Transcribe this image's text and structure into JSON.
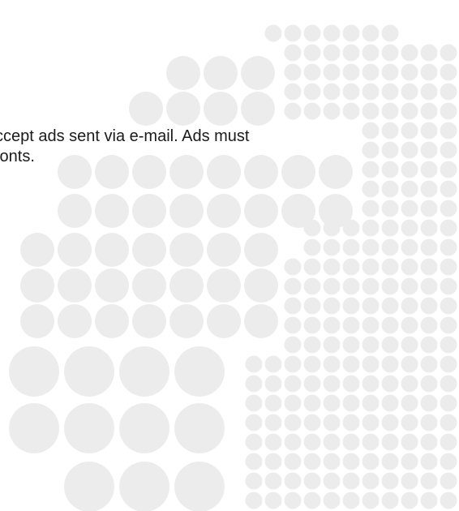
{
  "document": {
    "text_lines": [
      "ccept ads sent via e-mail. Ads must",
      " fonts."
    ]
  },
  "background": {
    "pattern": "halftone dot grid",
    "dot_color": "#ececec",
    "page_color": "#ffffff"
  }
}
